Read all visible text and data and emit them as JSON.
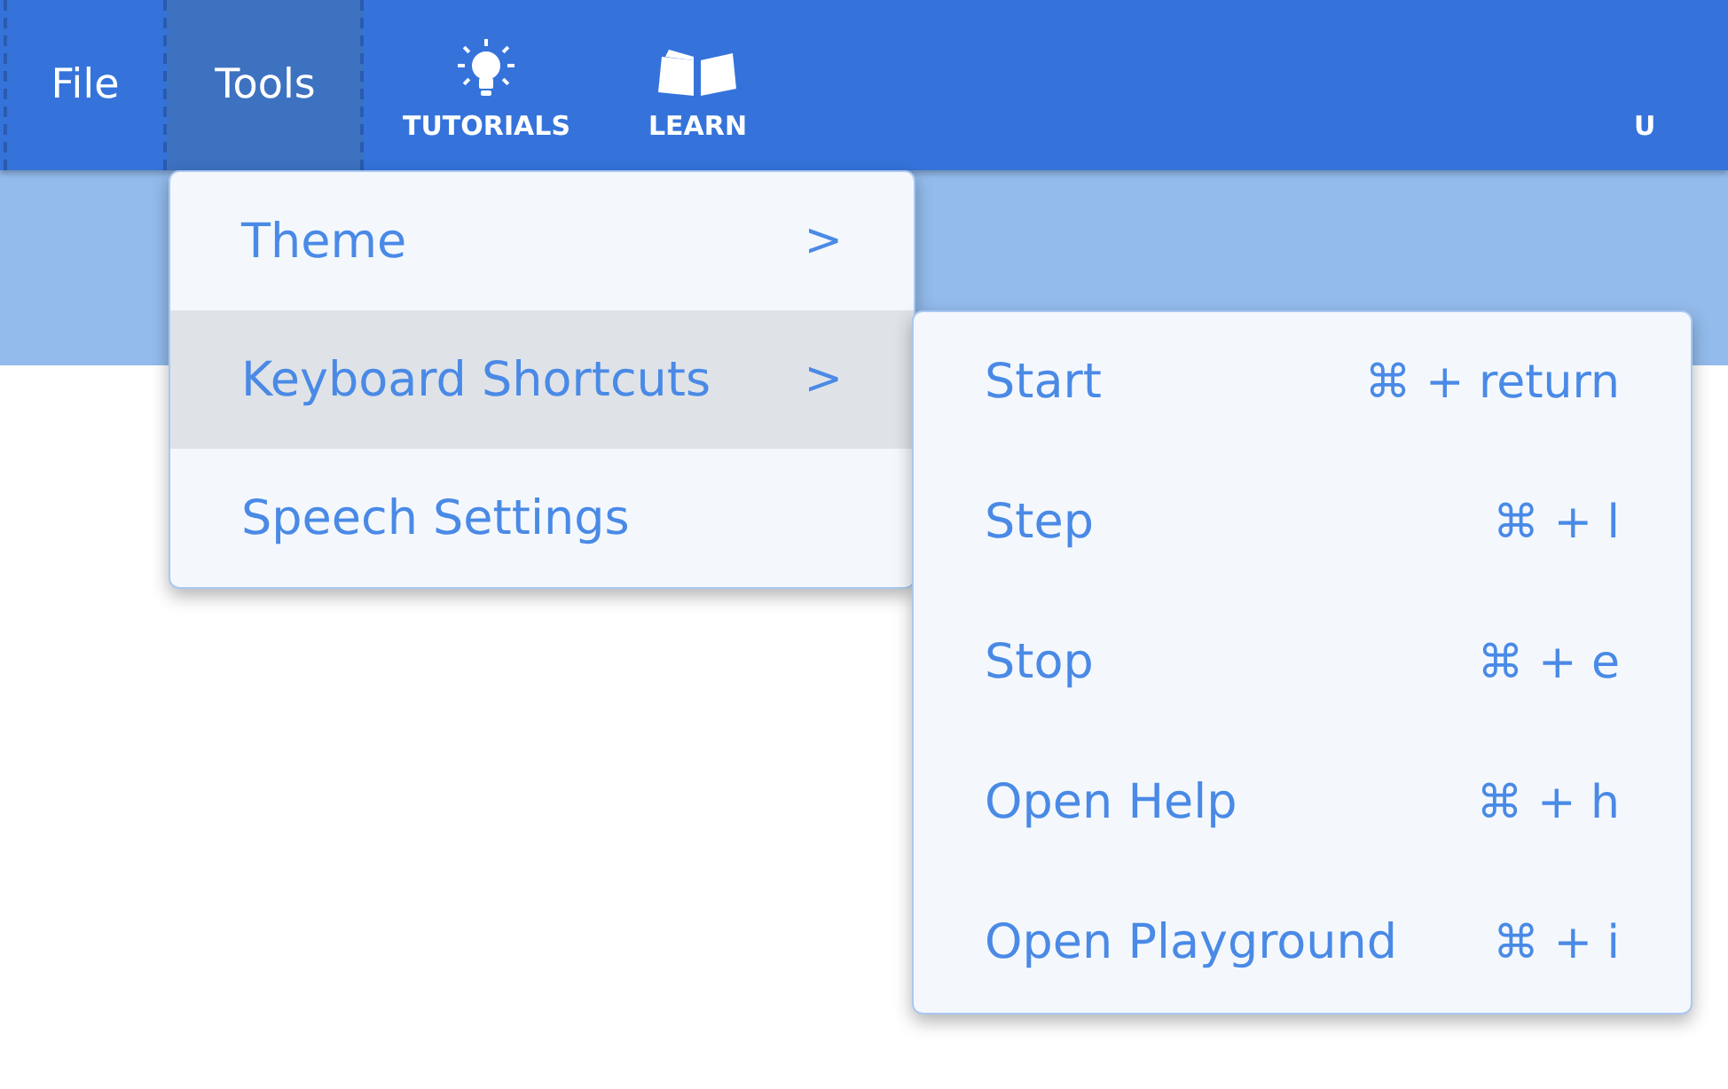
{
  "menu_bar": [
    {
      "label": "File",
      "selected": false
    },
    {
      "label": "Tools",
      "selected": true
    }
  ],
  "nav_links": [
    {
      "label": "TUTORIALS",
      "kind": "bulb"
    },
    {
      "label": "LEARN",
      "kind": "book"
    },
    {
      "label": "U",
      "kind": "none"
    }
  ],
  "tools_menu": [
    {
      "label": "Theme",
      "arrow": ">",
      "selected": false
    },
    {
      "label": "Keyboard Shortcuts",
      "arrow": ">",
      "selected": true
    },
    {
      "label": "Speech Settings",
      "selected": false
    }
  ],
  "shortcuts_menu": [
    {
      "label": "Start",
      "shortcut": "⌘ + return"
    },
    {
      "label": "Step",
      "shortcut": "⌘ + l"
    },
    {
      "label": "Stop",
      "shortcut": "⌘ + e"
    },
    {
      "label": "Open Help",
      "shortcut": "⌘ + h"
    },
    {
      "label": "Open Playground",
      "shortcut": "⌘ + i"
    }
  ]
}
